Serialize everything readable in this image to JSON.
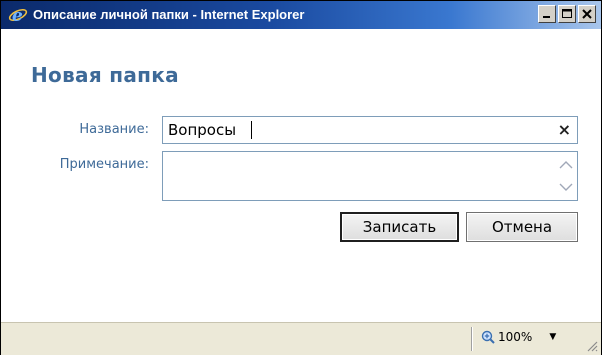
{
  "window": {
    "title": "Описание личной папки - Internet Explorer",
    "icon": "ie-logo-icon",
    "controls": [
      "minimize-icon",
      "maximize-icon",
      "close-icon"
    ]
  },
  "form": {
    "heading": "Новая папка",
    "name_label": "Название:",
    "name_value": "Вопросы",
    "clear_symbol": "×",
    "note_label": "Примечание:",
    "note_value": ""
  },
  "buttons": {
    "save": "Записать",
    "cancel": "Отмена"
  },
  "statusbar": {
    "zoom": "100%",
    "zoom_arrow": "▼"
  },
  "colors": {
    "titlebar_start": "#0b2a6b",
    "titlebar_end": "#a9c6ec",
    "label_color": "#3e6a98",
    "field_border": "#7e9db9",
    "status_bg": "#ece9d8"
  }
}
